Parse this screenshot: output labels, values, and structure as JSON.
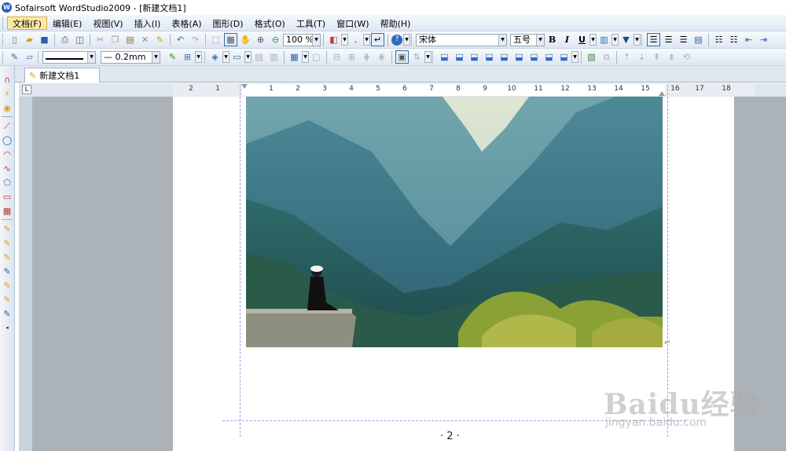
{
  "window": {
    "title": "Sofairsoft WordStudio2009 - [新建文档1]",
    "app_icon": "W"
  },
  "menubar": {
    "items": [
      "文档(F)",
      "编辑(E)",
      "视图(V)",
      "插入(I)",
      "表格(A)",
      "图形(D)",
      "格式(O)",
      "工具(T)",
      "窗口(W)",
      "帮助(H)"
    ],
    "active_index": 0
  },
  "toolbar1": {
    "zoom": "100 %",
    "font_name": "宋体",
    "font_size": "五号",
    "bold_label": "B",
    "italic_label": "I",
    "underline_label": "U"
  },
  "toolbar2": {
    "line_width": "0.2mm"
  },
  "tabs": [
    {
      "label": "新建文档1",
      "icon": "document-edit-icon"
    }
  ],
  "ruler": {
    "labels": [
      "2",
      "1",
      "1",
      "2",
      "3",
      "4",
      "5",
      "6",
      "7",
      "8",
      "9",
      "10",
      "11",
      "12",
      "13",
      "14",
      "15",
      "16",
      "17",
      "18"
    ]
  },
  "document": {
    "page_number": "· 2 ·",
    "image_description_icon": "landscape-photo"
  },
  "watermark": {
    "logo_text": "Baidu经验",
    "url": "jingyan.baidu.com"
  },
  "colors": {
    "menu_active": "#fbe8a6",
    "workspace_bg": "#abb3b9",
    "margin_guides": "#9aa2e0"
  }
}
